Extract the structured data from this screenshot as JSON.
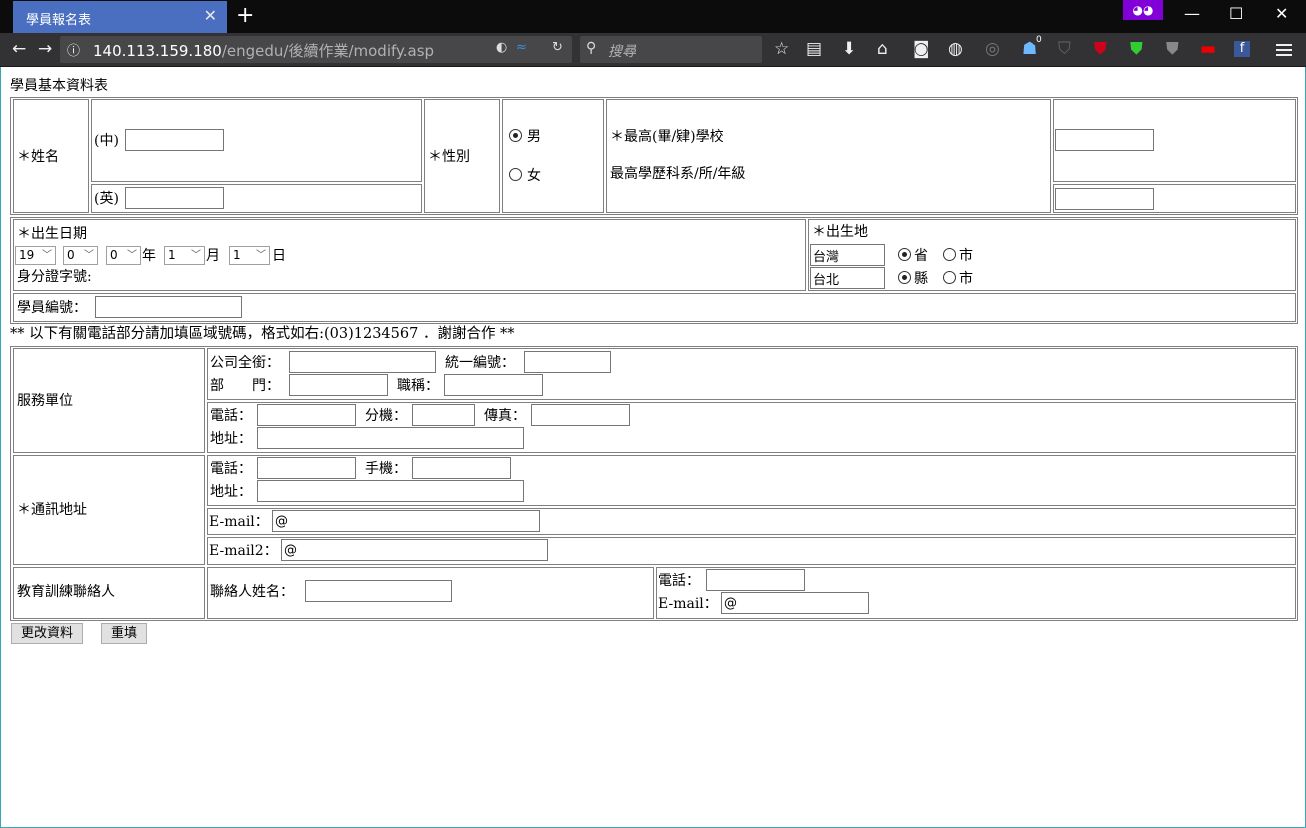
{
  "browser": {
    "tab_title": "學員報名表",
    "tab_close": "✕",
    "new_tab": "+",
    "url_host": "140.113.159.180",
    "url_path": "/engedu/後續作業/modify.asp",
    "search_placeholder": "搜尋",
    "ext_badge": "0",
    "min": "—",
    "max": "☐",
    "close": "✕"
  },
  "form": {
    "page_title": "學員基本資料表",
    "name_label": "＊姓名",
    "name_cn_label": "(中)",
    "name_en_label": "(英)",
    "gender_label": "＊性別",
    "gender_male": "男",
    "gender_female": "女",
    "school_label": "＊最高(畢/肄)學校",
    "dept_label": "最高學歷科系/所/年級",
    "birth_label": "＊出生日期",
    "birth_century": "19",
    "birth_year_tens": "0",
    "birth_year_ones": "0",
    "year_suffix": "年",
    "birth_month": "1",
    "month_suffix": "月",
    "birth_day": "1",
    "day_suffix": "日",
    "id_label": "身分證字號:",
    "birthplace_label": "＊出生地",
    "place_province_value": "台灣",
    "province_label": "省",
    "city_label": "市",
    "place_county_value": "台北",
    "county_label": "縣",
    "city2_label": "市",
    "student_no_label": "學員編號：",
    "phone_note": "** 以下有關電話部分請加填區域號碼，格式如右:(03)1234567 ．謝謝合作 **",
    "work_label": "服務單位",
    "company_label": "公司全銜：",
    "tax_id_label": "統一編號：",
    "department_label": "部　　門：",
    "title_label": "職稱：",
    "work_phone_label": "電話：",
    "ext_label": "分機：",
    "fax_label": "傳真：",
    "work_addr_label": "地址：",
    "contact_label": "＊通訊地址",
    "home_phone_label": "電話：",
    "mobile_label": "手機：",
    "home_addr_label": "地址：",
    "email_label": "E-mail：",
    "email_value": "@",
    "email2_label": "E-mail2：",
    "email2_value": "@",
    "trainer_label": "教育訓練聯絡人",
    "trainer_name_label": "聯絡人姓名：",
    "trainer_phone_label": "電話：",
    "trainer_email_label": "E-mail：",
    "trainer_email_value": "@",
    "submit_label": "更改資料",
    "reset_label": "重填"
  }
}
